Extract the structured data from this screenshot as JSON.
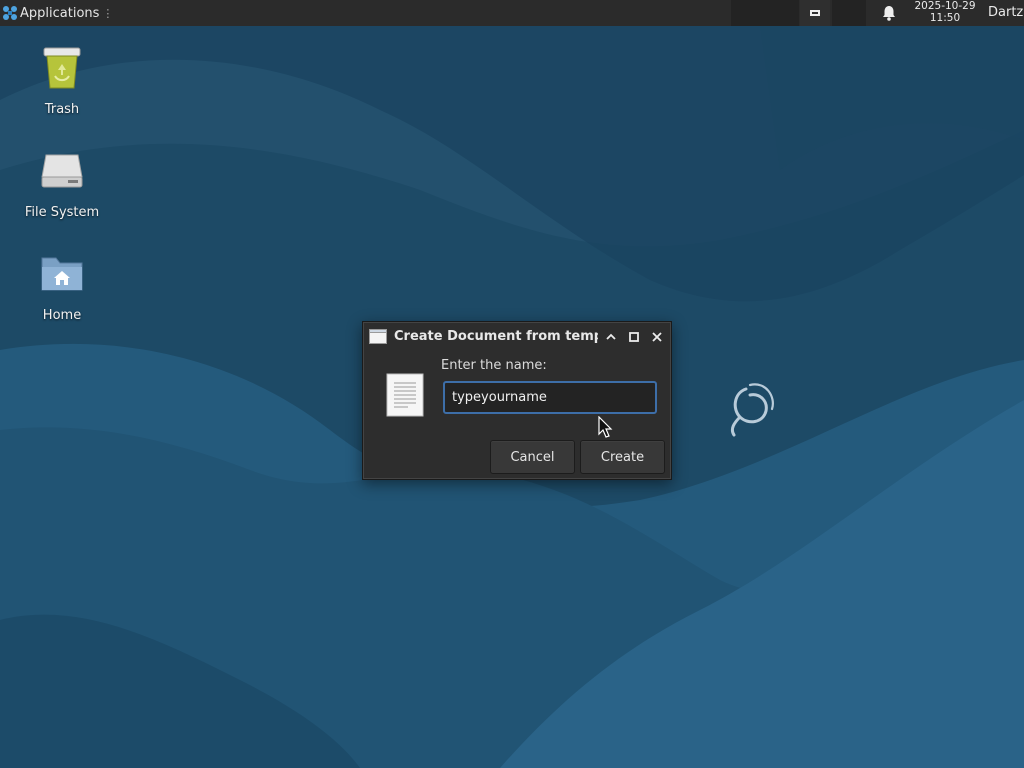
{
  "panel": {
    "applications_label": "Applications",
    "clock": {
      "date": "2025-10-29",
      "time": "11:50"
    },
    "user": "Dartz"
  },
  "desktop_icons": [
    {
      "label": "Trash",
      "icon": "trash-icon"
    },
    {
      "label": "File System",
      "icon": "drive-icon"
    },
    {
      "label": "Home",
      "icon": "home-folder-icon"
    }
  ],
  "dialog": {
    "title": "Create Document from templ...",
    "prompt": "Enter the name:",
    "name_value": "typeyourname",
    "cancel_label": "Cancel",
    "create_label": "Create"
  },
  "colors": {
    "panel": "#2b2b2b",
    "wallpaper": "#1f4f6d",
    "dialog_bg": "#2d2d2d",
    "focus_accent": "#3d6ea8"
  }
}
